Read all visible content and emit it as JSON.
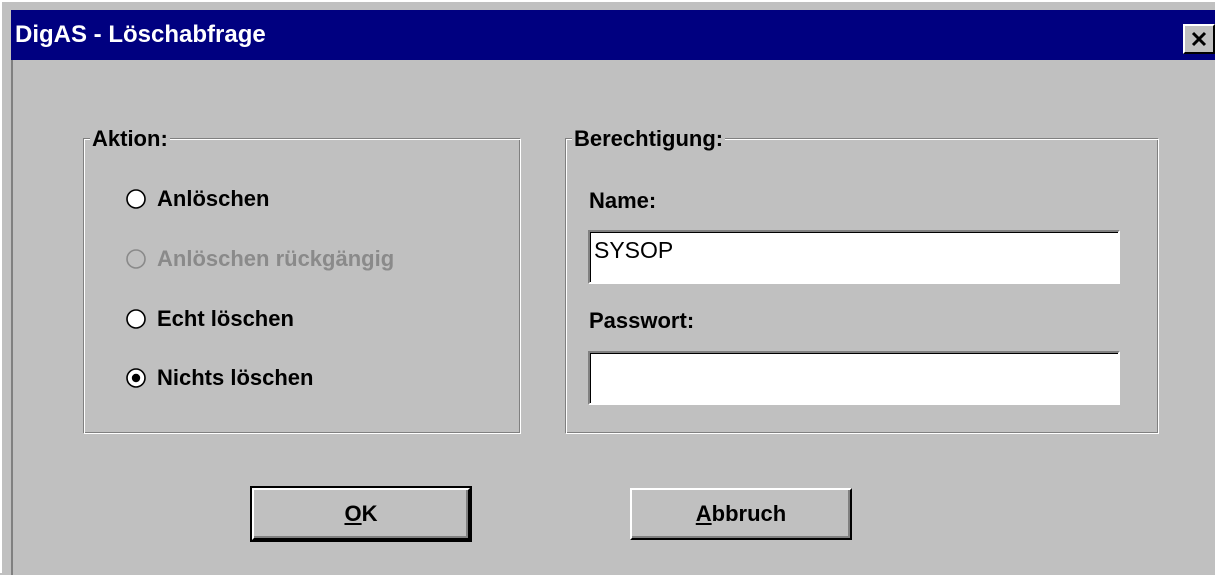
{
  "window": {
    "title": "DigAS - Löschabfrage",
    "close_icon": "close-icon"
  },
  "aktion": {
    "legend": "Aktion:",
    "options": [
      {
        "label": "Anlöschen",
        "selected": false,
        "enabled": true
      },
      {
        "label": "Anlöschen rückgängig",
        "selected": false,
        "enabled": false
      },
      {
        "label": "Echt löschen",
        "selected": false,
        "enabled": true
      },
      {
        "label": "Nichts löschen",
        "selected": true,
        "enabled": true
      }
    ]
  },
  "berechtigung": {
    "legend": "Berechtigung:",
    "name_label": "Name:",
    "name_value": "SYSOP",
    "password_label": "Passwort:",
    "password_value": ""
  },
  "buttons": {
    "ok_mnemonic": "O",
    "ok_rest": "K",
    "cancel_mnemonic": "A",
    "cancel_rest": "bbruch"
  },
  "colors": {
    "titlebar": "#000080",
    "face": "#c0c0c0",
    "disabled_text": "#8a8a8a"
  }
}
